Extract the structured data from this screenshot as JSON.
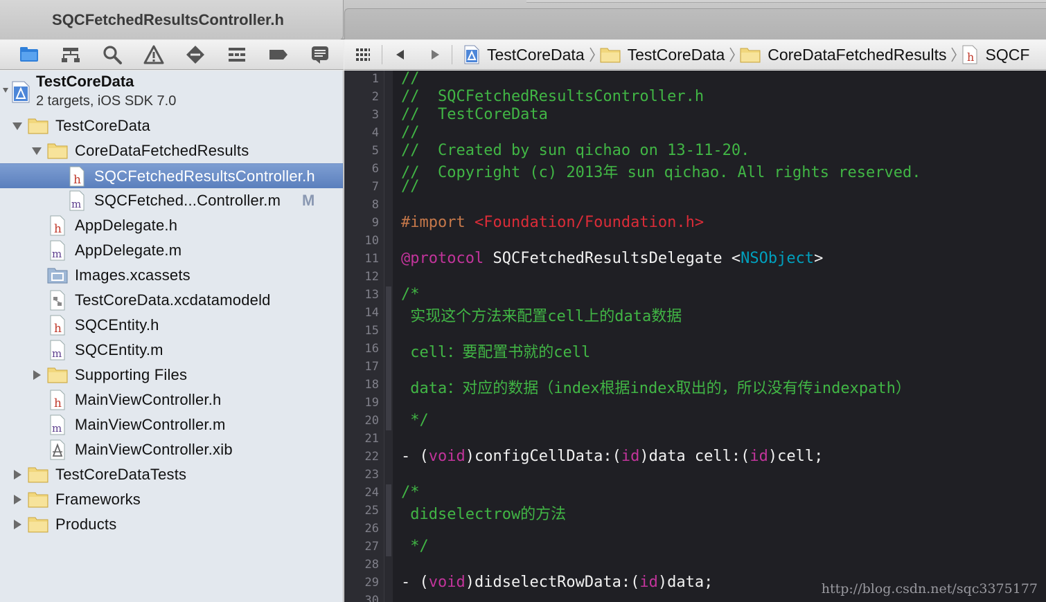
{
  "tab": {
    "active_title": "SQCFetchedResultsController.h"
  },
  "navigator_toolbar": {
    "icons": [
      "folder-icon",
      "hierarchy-icon",
      "search-icon",
      "warning-icon",
      "breakpoint-icon",
      "list-icon",
      "tag-icon",
      "log-icon"
    ]
  },
  "jumpbar": {
    "crumbs": [
      {
        "label": "TestCoreData",
        "icon": "project-icon"
      },
      {
        "label": "TestCoreData",
        "icon": "folder-icon"
      },
      {
        "label": "CoreDataFetchedResults",
        "icon": "folder-icon"
      },
      {
        "label": "SQCF",
        "icon": "header-file-icon"
      }
    ]
  },
  "project": {
    "name": "TestCoreData",
    "subtitle": "2 targets, iOS SDK 7.0"
  },
  "tree": [
    {
      "label": "TestCoreData",
      "type": "folder",
      "disclosure": "open"
    },
    {
      "label": "CoreDataFetchedResults",
      "type": "folder",
      "disclosure": "open"
    },
    {
      "label": "SQCFetchedResultsController.h",
      "type": "h",
      "selected": true
    },
    {
      "label": "SQCFetched...Controller.m",
      "type": "m",
      "badge": "M"
    },
    {
      "label": "AppDelegate.h",
      "type": "h"
    },
    {
      "label": "AppDelegate.m",
      "type": "m"
    },
    {
      "label": "Images.xcassets",
      "type": "assets"
    },
    {
      "label": "TestCoreData.xcdatamodeld",
      "type": "datamodel"
    },
    {
      "label": "SQCEntity.h",
      "type": "h"
    },
    {
      "label": "SQCEntity.m",
      "type": "m"
    },
    {
      "label": "Supporting Files",
      "type": "folder",
      "disclosure": "closed"
    },
    {
      "label": "MainViewController.h",
      "type": "h"
    },
    {
      "label": "MainViewController.m",
      "type": "m"
    },
    {
      "label": "MainViewController.xib",
      "type": "xib"
    },
    {
      "label": "TestCoreDataTests",
      "type": "folder",
      "disclosure": "closed"
    },
    {
      "label": "Frameworks",
      "type": "folder",
      "disclosure": "closed"
    },
    {
      "label": "Products",
      "type": "folder",
      "disclosure": "closed"
    }
  ],
  "editor": {
    "colors": {
      "comment": "#41b645",
      "directive": "#c6784a",
      "string": "#db2c38",
      "keyword": "#c2349b",
      "type": "#00a0be",
      "plain": "#f2f2f2",
      "background": "#1f1f24"
    },
    "lines": [
      {
        "n": "1",
        "tokens": [
          [
            "//",
            "comment"
          ]
        ]
      },
      {
        "n": "2",
        "tokens": [
          [
            "//  SQCFetchedResultsController.h",
            "comment"
          ]
        ]
      },
      {
        "n": "3",
        "tokens": [
          [
            "//  TestCoreData",
            "comment"
          ]
        ]
      },
      {
        "n": "4",
        "tokens": [
          [
            "//",
            "comment"
          ]
        ]
      },
      {
        "n": "5",
        "tokens": [
          [
            "//  Created by sun qichao on 13-11-20.",
            "comment"
          ]
        ]
      },
      {
        "n": "6",
        "tokens": [
          [
            "//  Copyright (c) 2013年 sun qichao. All rights reserved.",
            "comment"
          ]
        ]
      },
      {
        "n": "7",
        "tokens": [
          [
            "//",
            "comment"
          ]
        ]
      },
      {
        "n": "8",
        "tokens": []
      },
      {
        "n": "9",
        "tokens": [
          [
            "#import ",
            "directive"
          ],
          [
            "<Foundation/Foundation.h>",
            "string"
          ]
        ]
      },
      {
        "n": "10",
        "tokens": []
      },
      {
        "n": "11",
        "tokens": [
          [
            "@protocol",
            "keyword"
          ],
          [
            " SQCFetchedResultsDelegate <",
            "plain"
          ],
          [
            "NSObject",
            "type"
          ],
          [
            ">",
            "plain"
          ]
        ]
      },
      {
        "n": "12",
        "tokens": []
      },
      {
        "n": "13",
        "tokens": [
          [
            "/*",
            "comment"
          ]
        ]
      },
      {
        "n": "14",
        "tokens": [
          [
            " 实现这个方法来配置cell上的data数据",
            "comment"
          ]
        ]
      },
      {
        "n": "15",
        "tokens": []
      },
      {
        "n": "16",
        "tokens": [
          [
            " cell：要配置书就的cell",
            "comment"
          ]
        ]
      },
      {
        "n": "17",
        "tokens": []
      },
      {
        "n": "18",
        "tokens": [
          [
            " data：对应的数据（index根据index取出的，所以没有传indexpath）",
            "comment"
          ]
        ]
      },
      {
        "n": "19",
        "tokens": []
      },
      {
        "n": "20",
        "tokens": [
          [
            " */",
            "comment"
          ]
        ]
      },
      {
        "n": "21",
        "tokens": []
      },
      {
        "n": "22",
        "tokens": [
          [
            "- (",
            "plain"
          ],
          [
            "void",
            "keyword"
          ],
          [
            ")configCellData:(",
            "plain"
          ],
          [
            "id",
            "keyword"
          ],
          [
            ")data cell:(",
            "plain"
          ],
          [
            "id",
            "keyword"
          ],
          [
            ")cell;",
            "plain"
          ]
        ]
      },
      {
        "n": "23",
        "tokens": []
      },
      {
        "n": "24",
        "tokens": [
          [
            "/*",
            "comment"
          ]
        ]
      },
      {
        "n": "25",
        "tokens": [
          [
            " didselectrow的方法",
            "comment"
          ]
        ]
      },
      {
        "n": "26",
        "tokens": []
      },
      {
        "n": "27",
        "tokens": [
          [
            " */",
            "comment"
          ]
        ]
      },
      {
        "n": "28",
        "tokens": []
      },
      {
        "n": "29",
        "tokens": [
          [
            "- (",
            "plain"
          ],
          [
            "void",
            "keyword"
          ],
          [
            ")didselectRowData:(",
            "plain"
          ],
          [
            "id",
            "keyword"
          ],
          [
            ")data;",
            "plain"
          ]
        ]
      },
      {
        "n": "30",
        "tokens": []
      }
    ]
  },
  "watermark": "http://blog.csdn.net/sqc3375177"
}
